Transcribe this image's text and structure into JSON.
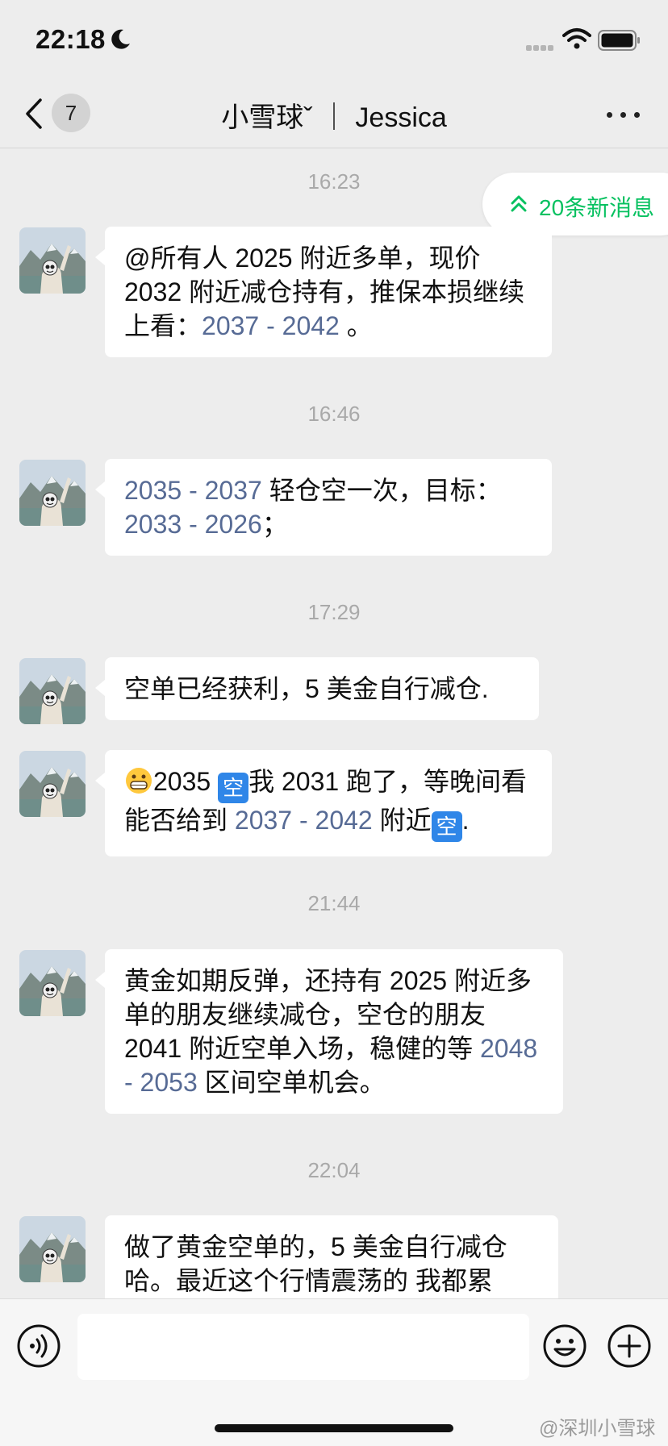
{
  "status_bar": {
    "time": "22:18"
  },
  "nav": {
    "unread_count": "7",
    "title": "小雪球ˇ ｜ Jessica"
  },
  "new_messages": {
    "label": "20条新消息"
  },
  "messages": [
    {
      "time": "16:23",
      "parts": [
        "@所有人 2025 附近多单，现价 2032 附近减仓持有，推保本损继续上看：",
        "2037 - 2042",
        " 。"
      ]
    },
    {
      "time": "16:46",
      "parts": [
        "2035 - 2037",
        " 轻仓空一次，目标：",
        "2033 - 2026",
        "；"
      ]
    },
    {
      "time": "17:29",
      "parts": [
        "空单已经获利，5 美金自行减仓."
      ]
    },
    {
      "parts": [
        "2035 ",
        "空",
        "我 2031 跑了，等晚间看能否给到 ",
        "2037 - 2042",
        " 附近",
        "空",
        "."
      ]
    },
    {
      "time": "21:44",
      "parts": [
        "黄金如期反弹，还持有 2025 附近多单的朋友继续减仓，空仓的朋友 2041 附近空单入场，稳健的等 ",
        "2048 - 2053",
        " 区间空单机会。"
      ]
    },
    {
      "time": "22:04",
      "parts": [
        "做了黄金空单的，5 美金自行减仓哈。最近这个行情震荡的 我都累"
      ]
    }
  ],
  "watermark": "@深圳小雪球",
  "colors": {
    "background": "#ededed",
    "bubble": "#ffffff",
    "link_number": "#576b95",
    "accent_green": "#07c160",
    "emoji_blue": "#2f86e8"
  },
  "icons": [
    "back-icon",
    "more-icon",
    "double-chevron-up-icon",
    "voice-icon",
    "emoji-icon",
    "plus-icon",
    "grinning-emoji-icon"
  ]
}
